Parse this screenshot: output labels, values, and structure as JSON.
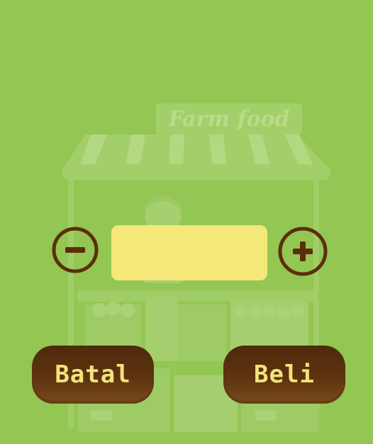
{
  "shop": {
    "sign_text": "Farm food"
  },
  "quantity": {
    "value": ""
  },
  "buttons": {
    "minus_icon": "minus-circle-icon",
    "plus_icon": "plus-circle-icon",
    "cancel_label": "Batal",
    "buy_label": "Beli"
  },
  "colors": {
    "background": "#93c652",
    "button_brown": "#5d330f",
    "button_text": "#f4e27a",
    "quantity_box": "#f3e878"
  }
}
